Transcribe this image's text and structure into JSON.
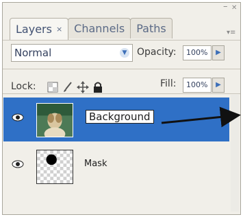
{
  "window": {
    "minimize_glyph": "–",
    "close_glyph": "✕",
    "menu_glyph": "▾≡"
  },
  "tabs": [
    {
      "label": "Layers",
      "close": "×"
    },
    {
      "label": "Channels"
    },
    {
      "label": "Paths"
    }
  ],
  "blend_mode": {
    "value": "Normal",
    "arrow": "▼"
  },
  "opacity": {
    "label": "Opacity:",
    "value": "100%",
    "flyout": "▶"
  },
  "lock": {
    "label": "Lock:",
    "icons": [
      "transparency-lock-icon",
      "brush-lock-icon",
      "move-lock-icon",
      "padlock-icon"
    ]
  },
  "fill": {
    "label": "Fill:",
    "value": "100%",
    "flyout": "▶"
  },
  "layers": [
    {
      "name": "Background",
      "selected": true,
      "editing": true,
      "visible": true
    },
    {
      "name": "Mask",
      "selected": false,
      "editing": false,
      "visible": true
    }
  ],
  "colors": {
    "selection": "#2f70c6",
    "panel": "#f1efe9",
    "arrow": "#111111"
  }
}
